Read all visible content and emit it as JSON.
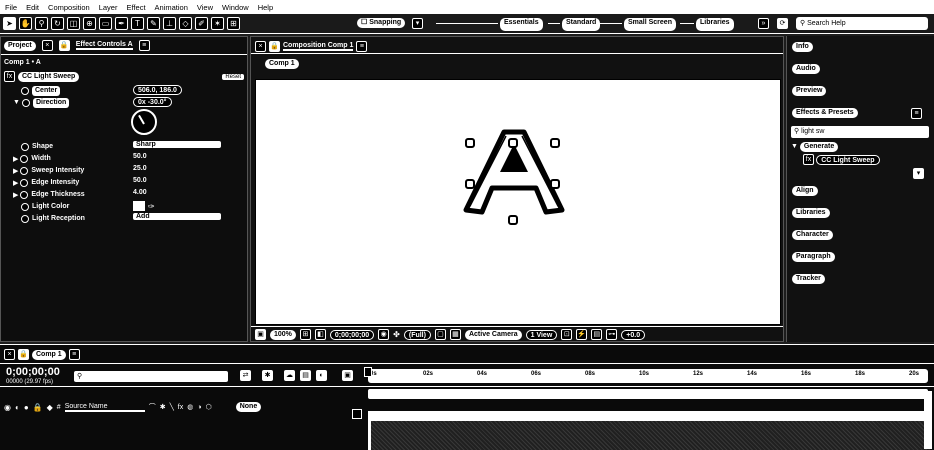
{
  "menu": [
    "File",
    "Edit",
    "Composition",
    "Layer",
    "Effect",
    "Animation",
    "View",
    "Window",
    "Help"
  ],
  "toolbar": {
    "snapping": "Snapping",
    "workspaces": [
      "Essentials",
      "Standard",
      "Small Screen",
      "Libraries"
    ],
    "search_placeholder": "Search Help"
  },
  "left_panel": {
    "tab_project": "Project",
    "tab_effect_controls": "Effect Controls A",
    "comp_path": "Comp 1 • A",
    "effect_name": "CC Light Sweep",
    "reset_label": "Reset",
    "properties": [
      {
        "name": "Center",
        "value": "506.0, 186.0"
      },
      {
        "name": "Direction",
        "value": "0x -30.0°"
      },
      {
        "name": "Shape",
        "value": "Sharp"
      },
      {
        "name": "Width",
        "value": "50.0"
      },
      {
        "name": "Sweep Intensity",
        "value": "25.0"
      },
      {
        "name": "Edge Intensity",
        "value": "50.0"
      },
      {
        "name": "Edge Thickness",
        "value": "4.00"
      },
      {
        "name": "Light Color",
        "value": ""
      },
      {
        "name": "Light Reception",
        "value": "Add"
      }
    ]
  },
  "comp_panel": {
    "tab": "Composition Comp 1",
    "subtab": "Comp 1",
    "letter": "A",
    "footer": {
      "zoom": "100%",
      "timecode": "0;00;00;00",
      "resolution": "(Full)",
      "camera": "Active Camera",
      "views": "1 View",
      "offset": "+0.0"
    }
  },
  "right_panel": {
    "items": [
      "Info",
      "Audio",
      "Preview",
      "Effects & Presets",
      "Align",
      "Libraries",
      "Character",
      "Paragraph",
      "Tracker"
    ],
    "search_value": "light sw",
    "category": "Generate",
    "effect_result": "CC Light Sweep"
  },
  "timeline": {
    "tab": "Comp 1",
    "timecode": "0;00;00;00",
    "frame_info": "00000 (29.97 fps)",
    "ruler_ticks": [
      "0s",
      "02s",
      "04s",
      "06s",
      "08s",
      "10s",
      "12s",
      "14s",
      "16s",
      "18s",
      "20s"
    ],
    "layer_header": "Source Name",
    "parent_none": "None"
  }
}
